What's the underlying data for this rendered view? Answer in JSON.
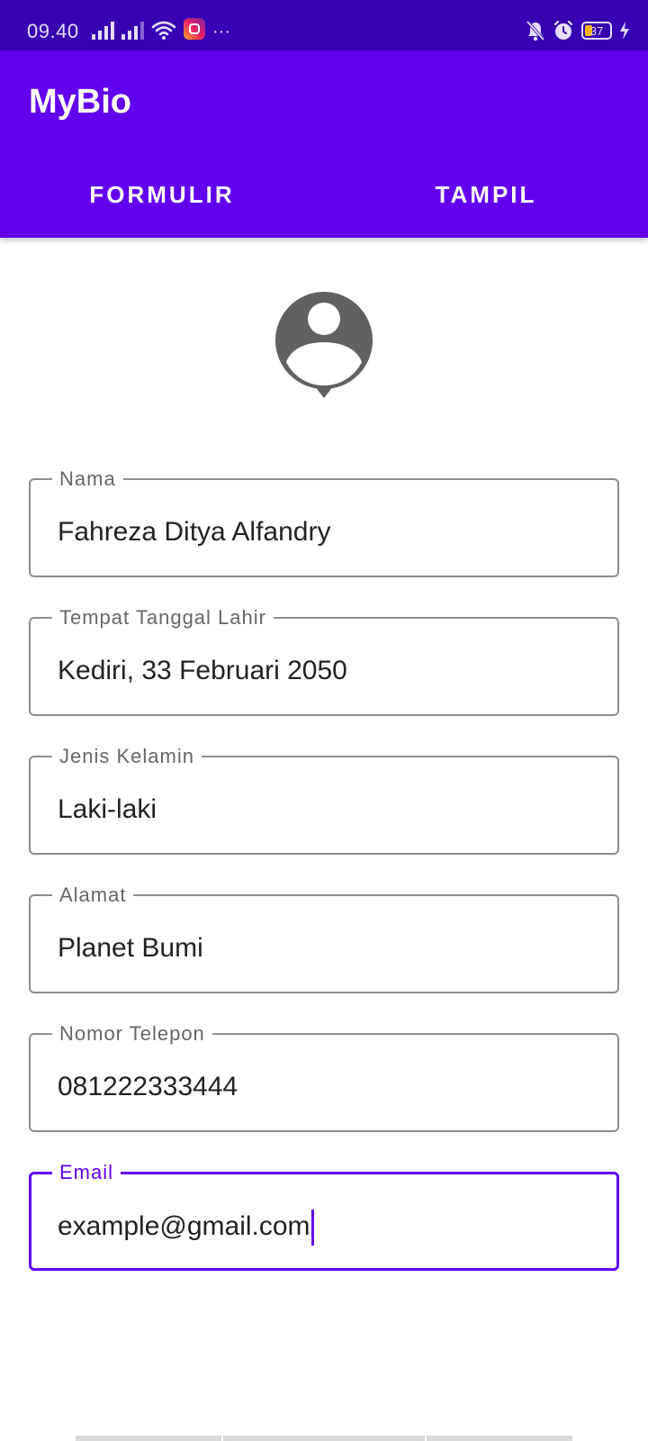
{
  "status_bar": {
    "time": "09.40",
    "battery_level": "37",
    "icons": [
      "signal-icon",
      "signal-icon",
      "wifi-icon",
      "instagram-icon",
      "more-dots-icon",
      "mute-notifications-icon",
      "alarm-icon",
      "battery-icon",
      "charging-icon"
    ]
  },
  "app_bar": {
    "title": "MyBio"
  },
  "tabs": [
    {
      "label": "FORMULIR"
    },
    {
      "label": "TAMPIL"
    }
  ],
  "avatar": {
    "icon": "person-pin-icon"
  },
  "form": {
    "fields": [
      {
        "label": "Nama",
        "value": "Fahreza Ditya Alfandry"
      },
      {
        "label": "Tempat Tanggal Lahir",
        "value": "Kediri, 33 Februari 2050"
      },
      {
        "label": "Jenis Kelamin",
        "value": "Laki-laki"
      },
      {
        "label": "Alamat",
        "value": "Planet Bumi"
      },
      {
        "label": "Nomor Telepon",
        "value": "081222333444"
      },
      {
        "label": "Email",
        "value": "example@gmail.com"
      }
    ]
  },
  "colors": {
    "primary": "#6200ee",
    "primary_dark": "#3700b3",
    "outline": "#8e8e8e"
  }
}
